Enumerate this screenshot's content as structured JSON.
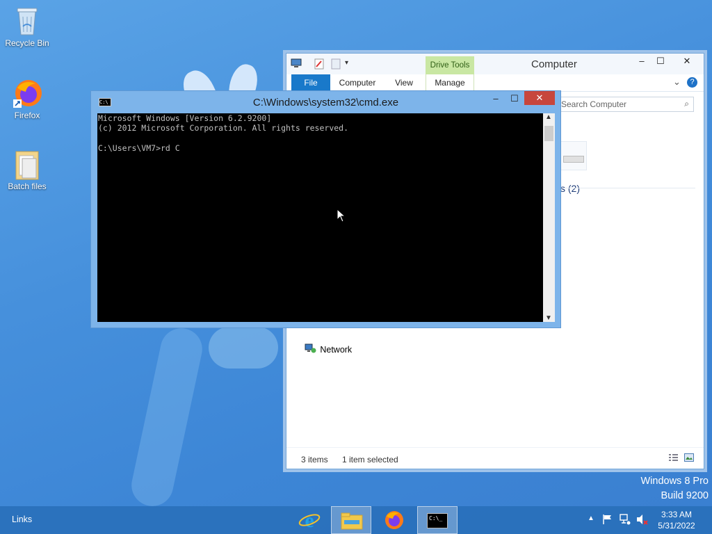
{
  "desktop": {
    "icons": [
      {
        "label": "Recycle Bin"
      },
      {
        "label": "Firefox"
      },
      {
        "label": "Batch files"
      }
    ],
    "watermark": {
      "line1": "Windows 8 Pro",
      "line2": "Build 9200"
    }
  },
  "explorer": {
    "title": "Computer",
    "contextual_tab": "Drive Tools",
    "tabs": [
      "File",
      "Computer",
      "View",
      "Manage"
    ],
    "search_placeholder": "Search Computer",
    "section_header": "Devices and drives (2)",
    "network_label": "Network",
    "status": {
      "items": "3 items",
      "selected": "1 item selected"
    }
  },
  "cmd": {
    "title": "C:\\Windows\\system32\\cmd.exe",
    "lines": [
      "Microsoft Windows [Version 6.2.9200]",
      "(c) 2012 Microsoft Corporation. All rights reserved.",
      "",
      "C:\\Users\\VM7>rd C"
    ]
  },
  "taskbar": {
    "links_label": "Links",
    "clock_time": "3:33 AM",
    "clock_date": "5/31/2022"
  },
  "colors": {
    "accent": "#1979ca",
    "drive_tools_bg": "#c9e7a3",
    "close_red": "#c7463c"
  }
}
